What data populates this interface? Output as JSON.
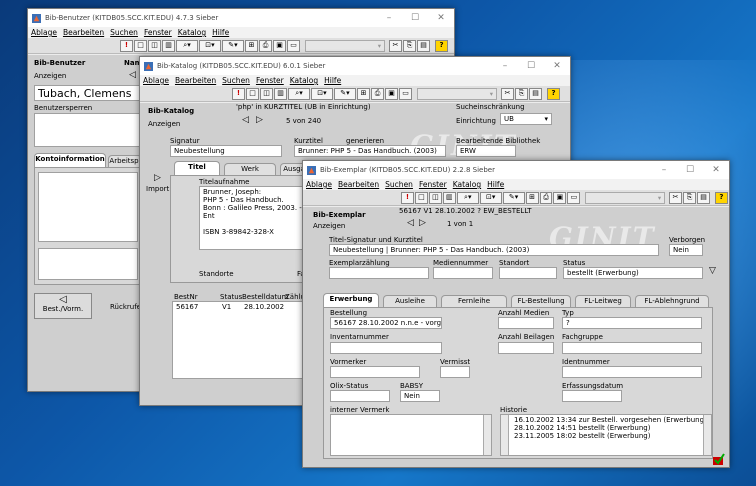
{
  "colors": {
    "desktop": "#0d57a8",
    "title_bg": "#ffffff",
    "panel": "#cfcfcf",
    "yellow_btn": "#ffd400"
  },
  "win1": {
    "title": "Bib-Benutzer  (KITDB05.SCC.KIT.EDU)  4.7.3  Sieber",
    "menu": [
      "Ablage",
      "Bearbeiten",
      "Suchen",
      "Fenster",
      "Katalog",
      "Hilfe"
    ],
    "header_label": "Bib-Benutzer",
    "header_label2": "Name",
    "anzeigen": "Anzeigen",
    "name_value": "Tubach, Clemens",
    "benutzersperren": "Benutzersperren",
    "tabs": [
      "Kontoinformation",
      "Arbeitspl"
    ],
    "back_label": "Best./Vorm.",
    "rueckrufen": "Rückrufen"
  },
  "win2": {
    "title": "Bib-Katalog  (KITDB05.SCC.KIT.EDU)  6.0.1  Sieber",
    "menu": [
      "Ablage",
      "Bearbeiten",
      "Suchen",
      "Fenster",
      "Katalog",
      "Hilfe"
    ],
    "header_label": "Bib-Katalog",
    "query": "'php' in KURZTITEL (UB in Einrichtung)",
    "counter": "5 von 240",
    "anzeigen": "Anzeigen",
    "sucheinschraenkung": "Sucheinschränkung",
    "einrichtung_label": "Einrichtung",
    "einrichtung_value": "UB",
    "signatur_label": "Signatur",
    "signatur_value": "Neubestellung",
    "kurztitel_label": "Kurztitel",
    "generieren": "generieren",
    "kurztitel_value": "Brunner: PHP 5 - Das Handbuch. (2003)",
    "bearb_label": "Bearbeitende Bibliothek",
    "bearb_value": "ERW",
    "tabs": [
      "Titel",
      "Werk",
      "Ausgal"
    ],
    "import": "Import",
    "titelaufnahme": "Titelaufnahme",
    "titel_lines": [
      "Brunner, Joseph:",
      "PHP 5 - Das Handbuch.",
      "Bonn : Galileo Press, 2003. - Ent",
      "",
      "ISBN 3-89842-328-X"
    ],
    "standorte": "Standorte",
    "fa": "Fa",
    "table_headers": [
      "BestNr",
      "Status",
      "Bestelldatum",
      "Zählu"
    ],
    "table_row": [
      "56167",
      "V1",
      "28.10.2002"
    ]
  },
  "win3": {
    "title": "Bib-Exemplar  (KITDB05.SCC.KIT.EDU)  2.2.8  Sieber",
    "menu": [
      "Ablage",
      "Bearbeiten",
      "Suchen",
      "Fenster",
      "Katalog",
      "Hilfe"
    ],
    "header_label": "Bib-Exemplar",
    "header_value": "56167   V1   28.10.2002          ?   EW_BESTELLT",
    "anzeigen": "Anzeigen",
    "counter": "1 von 1",
    "titelsig_label": "Titel-Signatur und Kurztitel",
    "titelsig_value": "Neubestellung | Brunner: PHP 5 - Das Handbuch. (2003)",
    "verborgen_label": "Verborgen",
    "verborgen_value": "Nein",
    "exemplarzaehlung": "Exemplarzählung",
    "mediennummer": "Mediennummer",
    "standort": "Standort",
    "status_label": "Status",
    "status_value": "bestellt (Erwerbung)",
    "tabs": [
      "Erwerbung",
      "Ausleihe",
      "Fernleihe",
      "FL-Bestellung",
      "FL-Leitweg",
      "FL-Ablehngrund"
    ],
    "bestellung_label": "Bestellung",
    "bestellung_value": "56167 28.10.2002 n.n.e - vorgr",
    "anzahl_medien_label": "Anzahl Medien",
    "typ_label": "Typ",
    "typ_value": "?",
    "inventarnummer": "Inventarnummer",
    "anzahl_beilagen": "Anzahl Beilagen",
    "fachgruppe": "Fachgruppe",
    "vormerker": "Vormerker",
    "vermisst": "Vermisst",
    "identnummer": "Identnummer",
    "olix_label": "Olix-Status",
    "babsy_label": "BABSY",
    "babsy_value": "Nein",
    "erfassungsdatum": "Erfassungsdatum",
    "interner_vermerk": "interner Vermerk",
    "historie_label": "Historie",
    "historie_lines": [
      "16.10.2002 13:34 zur Bestell. vorgesehen (Erwerbung)",
      "28.10.2002 14:51 bestellt (Erwerbung)",
      "23.11.2005 18:02 bestellt (Erwerbung)"
    ]
  },
  "watermark": "GINIT"
}
